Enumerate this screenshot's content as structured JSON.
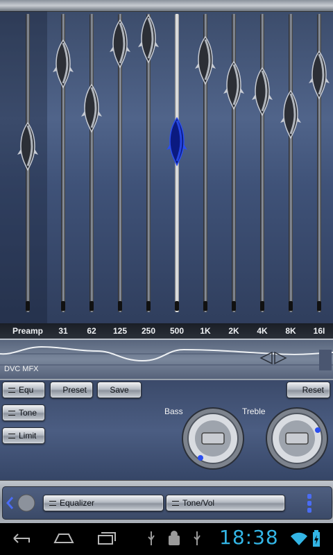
{
  "equalizer": {
    "bands": [
      {
        "label": "Preamp",
        "level": 0.35
      },
      {
        "label": "31",
        "level": 0.85
      },
      {
        "label": "62",
        "level": 0.58
      },
      {
        "label": "125",
        "level": 0.97
      },
      {
        "label": "250",
        "level": 1.0
      },
      {
        "label": "500",
        "level": 0.38
      },
      {
        "label": "1K",
        "level": 0.87
      },
      {
        "label": "2K",
        "level": 0.72
      },
      {
        "label": "4K",
        "level": 0.68
      },
      {
        "label": "8K",
        "level": 0.54
      },
      {
        "label": "16I",
        "level": 0.78
      }
    ],
    "active_band_index": 5,
    "knob_color": "#c8ccd4",
    "active_knob_color": "#2a4ef0"
  },
  "effects": {
    "label": "DVC MFX"
  },
  "buttons": {
    "equ": "Equ",
    "tone": "Tone",
    "limit": "Limit",
    "preset": "Preset",
    "save": "Save",
    "reset": "Reset"
  },
  "dials": {
    "bass_label": "Bass",
    "treble_label": "Treble"
  },
  "footer": {
    "equalizer_tab": "Equalizer",
    "tone_vol_tab": "Tone/Vol"
  },
  "status": {
    "time": "18:38",
    "accent": "#33b5e5"
  }
}
